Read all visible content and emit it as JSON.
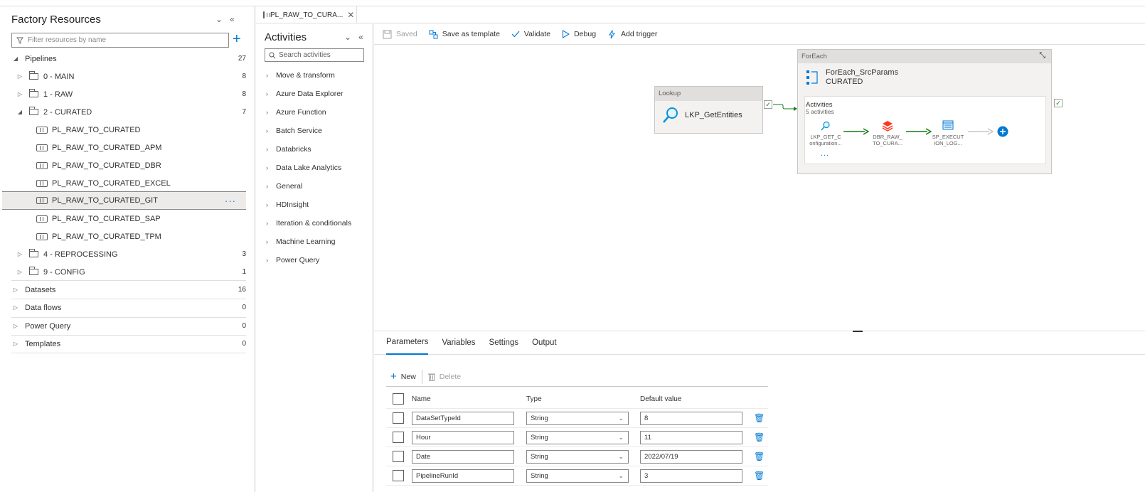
{
  "factory": {
    "title": "Factory Resources",
    "filter_placeholder": "Filter resources by name",
    "tree": [
      {
        "label": "Pipelines",
        "count": "27"
      },
      {
        "label": "0 - MAIN",
        "count": "8"
      },
      {
        "label": "1 - RAW",
        "count": "8"
      },
      {
        "label": "2 - CURATED",
        "count": "7"
      },
      {
        "label": "PL_RAW_TO_CURATED",
        "count": ""
      },
      {
        "label": "PL_RAW_TO_CURATED_APM",
        "count": ""
      },
      {
        "label": "PL_RAW_TO_CURATED_DBR",
        "count": ""
      },
      {
        "label": "PL_RAW_TO_CURATED_EXCEL",
        "count": ""
      },
      {
        "label": "PL_RAW_TO_CURATED_GIT",
        "count": ""
      },
      {
        "label": "PL_RAW_TO_CURATED_SAP",
        "count": ""
      },
      {
        "label": "PL_RAW_TO_CURATED_TPM",
        "count": ""
      },
      {
        "label": "4 - REPROCESSING",
        "count": "3"
      },
      {
        "label": "9 - CONFIG",
        "count": "1"
      },
      {
        "label": "Datasets",
        "count": "16"
      },
      {
        "label": "Data flows",
        "count": "0"
      },
      {
        "label": "Power Query",
        "count": "0"
      },
      {
        "label": "Templates",
        "count": "0"
      }
    ]
  },
  "tab": {
    "label": "PL_RAW_TO_CURA..."
  },
  "activities": {
    "title": "Activities",
    "search_placeholder": "Search activities",
    "items": [
      "Move & transform",
      "Azure Data Explorer",
      "Azure Function",
      "Batch Service",
      "Databricks",
      "Data Lake Analytics",
      "General",
      "HDInsight",
      "Iteration & conditionals",
      "Machine Learning",
      "Power Query"
    ]
  },
  "toolbar": {
    "saved": "Saved",
    "save_template": "Save as template",
    "validate": "Validate",
    "debug": "Debug",
    "add_trigger": "Add trigger"
  },
  "canvas": {
    "lookup": {
      "type": "Lookup",
      "name": "LKP_GetEntities"
    },
    "foreach": {
      "type": "ForEach",
      "name": "ForEach_SrcParams",
      "subtitle": "CURATED",
      "inner_label": "Activities",
      "inner_count": "5 activities",
      "more": "...",
      "nodes": [
        {
          "line1": "LKP_GET_C",
          "line2": "onfiguration..."
        },
        {
          "line1": "DBR_RAW_",
          "line2": "TO_CURA..."
        },
        {
          "line1": "SP_EXECUT",
          "line2": "ION_LOG..."
        }
      ]
    }
  },
  "bottom": {
    "tabs": [
      "Parameters",
      "Variables",
      "Settings",
      "Output"
    ],
    "new": "New",
    "delete": "Delete",
    "headers": {
      "name": "Name",
      "type": "Type",
      "default": "Default value"
    },
    "params": [
      {
        "name": "DataSetTypeId",
        "type": "String",
        "default": "8"
      },
      {
        "name": "Hour",
        "type": "String",
        "default": "11"
      },
      {
        "name": "Date",
        "type": "String",
        "default": "2022/07/19"
      },
      {
        "name": "PipelineRunId",
        "type": "String",
        "default": "3"
      }
    ]
  },
  "colors": {
    "accent": "#0078d4",
    "success": "#107c10",
    "selected_row": "#edebe9"
  }
}
